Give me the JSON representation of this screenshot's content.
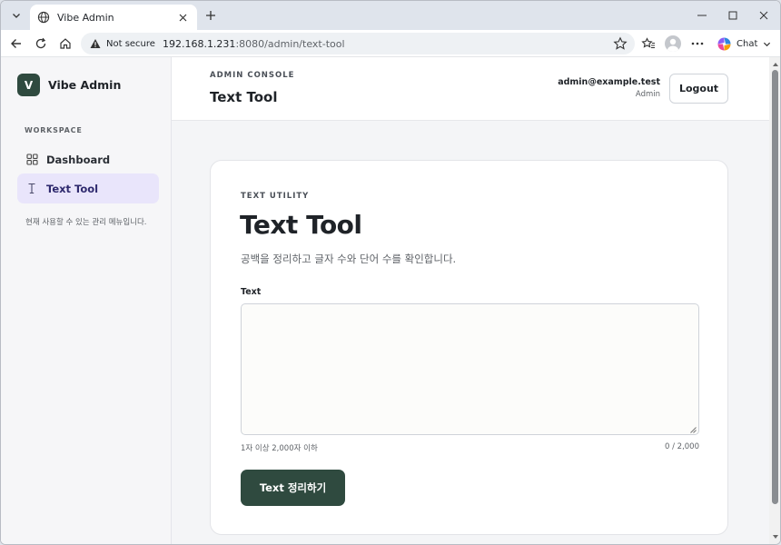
{
  "browser": {
    "tab_title": "Vibe Admin",
    "security_label": "Not secure",
    "url_host": "192.168.1.231",
    "url_path": ":8080/admin/text-tool",
    "chat_label": "Chat"
  },
  "sidebar": {
    "brand_initial": "V",
    "brand_name": "Vibe Admin",
    "section_label": "WORKSPACE",
    "items": [
      {
        "label": "Dashboard",
        "icon": "grid-icon",
        "active": false
      },
      {
        "label": "Text Tool",
        "icon": "text-cursor-icon",
        "active": true
      }
    ],
    "note": "현재 사용할 수 있는 관리 메뉴입니다."
  },
  "header": {
    "eyebrow": "ADMIN CONSOLE",
    "title": "Text Tool",
    "user_email": "admin@example.test",
    "user_role": "Admin",
    "logout_label": "Logout"
  },
  "card": {
    "eyebrow": "TEXT UTILITY",
    "title": "Text Tool",
    "subtitle": "공백을 정리하고 글자 수와 단어 수를 확인합니다.",
    "field_label": "Text",
    "field_value": "",
    "hint": "1자 이상 2,000자 이하",
    "count": "0 / 2,000",
    "submit_label": "Text 정리하기"
  },
  "colors": {
    "brand": "#2f4a3f",
    "active_nav_bg": "#e9e5fb"
  }
}
